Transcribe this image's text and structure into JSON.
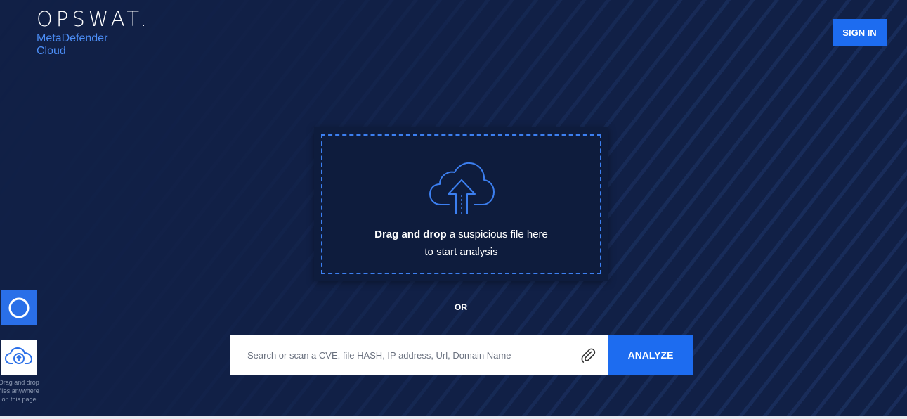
{
  "brand": {
    "wordmark": "OPSWAT.",
    "product": "MetaDefender Cloud"
  },
  "header": {
    "signin_label": "SIGN IN"
  },
  "dropzone": {
    "bold_text": "Drag and drop",
    "text": " a suspicious file here",
    "line2": "to start analysis",
    "icon": "cloud-upload-icon"
  },
  "or_label": "OR",
  "search": {
    "placeholder": "Search or scan a CVE, file HASH, IP address, Url, Domain Name",
    "value": "",
    "attach_icon": "paperclip-icon",
    "analyze_label": "ANALYZE"
  },
  "side_widgets": {
    "caption": "Drag and drop files anywhere on this page"
  },
  "colors": {
    "background": "#112046",
    "accent": "#1d6cf0",
    "brand_blue": "#4c8ef7"
  }
}
